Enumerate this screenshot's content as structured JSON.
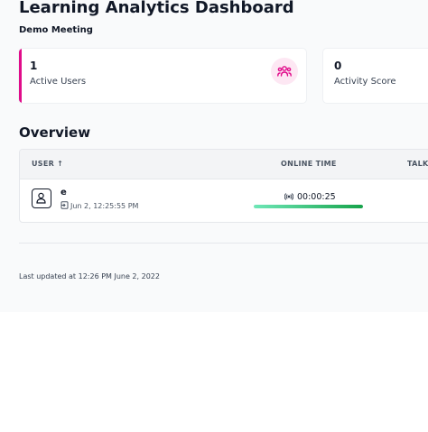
{
  "dashboard": {
    "title": "Learning Analytics Dashboard",
    "meeting_name": "Demo Meeting"
  },
  "cards": {
    "active_users": {
      "value": "1",
      "label": "Active Users",
      "icon": "users-icon",
      "accent_color": "#e00b8a"
    },
    "activity_score": {
      "value": "0",
      "label": "Activity Score"
    }
  },
  "overview": {
    "title": "Overview",
    "columns": {
      "user": "USER ↑",
      "online_time": "ONLINE TIME",
      "talk": "TALK"
    },
    "rows": [
      {
        "name": "e",
        "joined": "Jun 2, 12:25:55 PM",
        "online_time": "00:00:25",
        "online_progress": 1.0
      }
    ]
  },
  "footer": {
    "last_updated": "Last updated at 12:26 PM June 2, 2022"
  }
}
